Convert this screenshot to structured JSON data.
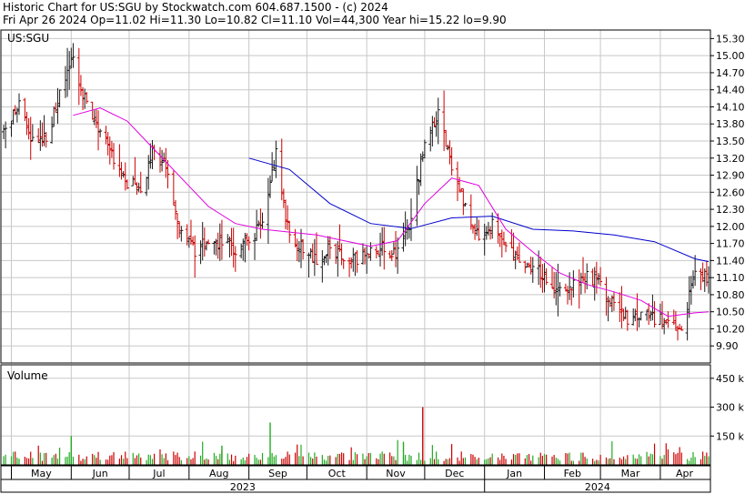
{
  "header": {
    "title_line": "Historic Chart for US:SGU by Stockwatch.com 604.687.1500 - (c) 2024",
    "stats_line": "Fri Apr 26 2024   Op=11.02   Hi=11.30   Lo=10.82   Cl=11.10   Vol=44,300   Year hi=15.22   lo=9.90"
  },
  "price_panel": {
    "symbol_label": "US:SGU"
  },
  "volume_panel": {
    "label": "Volume"
  },
  "colors": {
    "up_bar": "#1a1a1a",
    "down_bar": "#cc0000",
    "ma_short": "#e000e0",
    "ma_long": "#0000cc",
    "vol_up": "#22aa22",
    "vol_down": "#cc0000",
    "grid": "#c8c8c8",
    "background": "#ffffff"
  },
  "chart_data": [
    {
      "type": "line",
      "subtype": "ohlc-bar",
      "title": "Historic Chart for US:SGU by Stockwatch.com 604.687.1500 - (c) 2024",
      "symbol": "US:SGU",
      "date_range": [
        "2023-04-27",
        "2024-04-26"
      ],
      "ylim": [
        9.6,
        15.45
      ],
      "y_scale": "linear",
      "y_ticks": [
        "15.30",
        "15.00",
        "14.70",
        "14.40",
        "14.10",
        "13.80",
        "13.50",
        "13.20",
        "12.90",
        "12.60",
        "12.30",
        "12.00",
        "11.70",
        "11.40",
        "11.10",
        "10.80",
        "10.50",
        "10.20",
        "9.90"
      ],
      "x_ticks": [
        "May",
        "Jun",
        "Jul",
        "Aug",
        "Sep",
        "Oct",
        "Nov",
        "Dec",
        "Jan",
        "Feb",
        "Mar",
        "Apr"
      ],
      "x_years": [
        "2023",
        "2024"
      ],
      "grid": true,
      "last_bar": {
        "date": "2024-04-26",
        "open": 11.02,
        "high": 11.3,
        "low": 10.82,
        "close": 11.1,
        "volume": 44300
      },
      "year_high": 15.22,
      "year_low": 9.9,
      "close_series": {
        "name": "Close",
        "x": [
          "2023-04-28",
          "2023-05-05",
          "2023-05-12",
          "2023-05-19",
          "2023-05-26",
          "2023-06-02",
          "2023-06-09",
          "2023-06-16",
          "2023-06-23",
          "2023-06-30",
          "2023-07-07",
          "2023-07-14",
          "2023-07-21",
          "2023-07-28",
          "2023-08-04",
          "2023-08-11",
          "2023-08-18",
          "2023-08-25",
          "2023-09-01",
          "2023-09-08",
          "2023-09-15",
          "2023-09-22",
          "2023-09-29",
          "2023-10-06",
          "2023-10-13",
          "2023-10-20",
          "2023-10-27",
          "2023-11-03",
          "2023-11-10",
          "2023-11-17",
          "2023-11-24",
          "2023-12-01",
          "2023-12-08",
          "2023-12-15",
          "2023-12-22",
          "2023-12-29",
          "2024-01-05",
          "2024-01-12",
          "2024-01-19",
          "2024-01-26",
          "2024-02-02",
          "2024-02-09",
          "2024-02-16",
          "2024-02-23",
          "2024-03-01",
          "2024-03-08",
          "2024-03-15",
          "2024-03-22",
          "2024-03-29",
          "2024-04-05",
          "2024-04-12",
          "2024-04-19",
          "2024-04-26"
        ],
        "values": [
          13.7,
          14.1,
          13.5,
          13.6,
          14.3,
          15.0,
          14.1,
          13.6,
          13.2,
          12.8,
          12.6,
          13.4,
          12.9,
          11.9,
          11.6,
          11.8,
          11.7,
          11.6,
          11.8,
          12.0,
          13.3,
          11.8,
          11.6,
          11.4,
          11.6,
          11.5,
          11.4,
          11.6,
          11.6,
          11.5,
          12.1,
          13.5,
          14.0,
          13.1,
          12.3,
          11.8,
          12.0,
          11.7,
          11.4,
          11.3,
          11.1,
          10.9,
          11.0,
          11.1,
          11.0,
          10.6,
          10.4,
          10.5,
          10.4,
          10.4,
          10.2,
          11.2,
          11.1
        ]
      }
    },
    {
      "type": "line",
      "name": "Short moving average",
      "x": [
        "2023-06-02",
        "2023-06-16",
        "2023-06-30",
        "2023-07-14",
        "2023-07-28",
        "2023-08-11",
        "2023-08-25",
        "2023-09-08",
        "2023-09-22",
        "2023-10-06",
        "2023-10-20",
        "2023-11-03",
        "2023-11-17",
        "2023-12-01",
        "2023-12-15",
        "2023-12-29",
        "2024-01-12",
        "2024-01-26",
        "2024-02-09",
        "2024-02-23",
        "2024-03-08",
        "2024-03-22",
        "2024-04-05",
        "2024-04-19",
        "2024-04-26"
      ],
      "values": [
        13.95,
        14.08,
        13.85,
        13.35,
        12.85,
        12.35,
        12.05,
        11.95,
        11.9,
        11.85,
        11.75,
        11.65,
        11.75,
        12.4,
        12.85,
        12.72,
        11.95,
        11.55,
        11.18,
        10.98,
        10.85,
        10.7,
        10.42,
        10.48,
        10.5
      ]
    },
    {
      "type": "line",
      "name": "Long moving average",
      "x": [
        "2023-09-01",
        "2023-09-22",
        "2023-10-13",
        "2023-11-03",
        "2023-11-24",
        "2023-12-15",
        "2024-01-05",
        "2024-01-26",
        "2024-02-16",
        "2024-03-08",
        "2024-03-29",
        "2024-04-19",
        "2024-04-26"
      ],
      "values": [
        13.2,
        13.0,
        12.4,
        12.05,
        11.96,
        12.15,
        12.18,
        11.95,
        11.92,
        11.85,
        11.73,
        11.43,
        11.38
      ]
    },
    {
      "type": "bar",
      "name": "Volume",
      "ylim": [
        0,
        520000
      ],
      "y_ticks": [
        "450 k",
        "300 k",
        "150 k"
      ],
      "peak_volume": 300000,
      "peak_date": "2023-11-30"
    }
  ]
}
